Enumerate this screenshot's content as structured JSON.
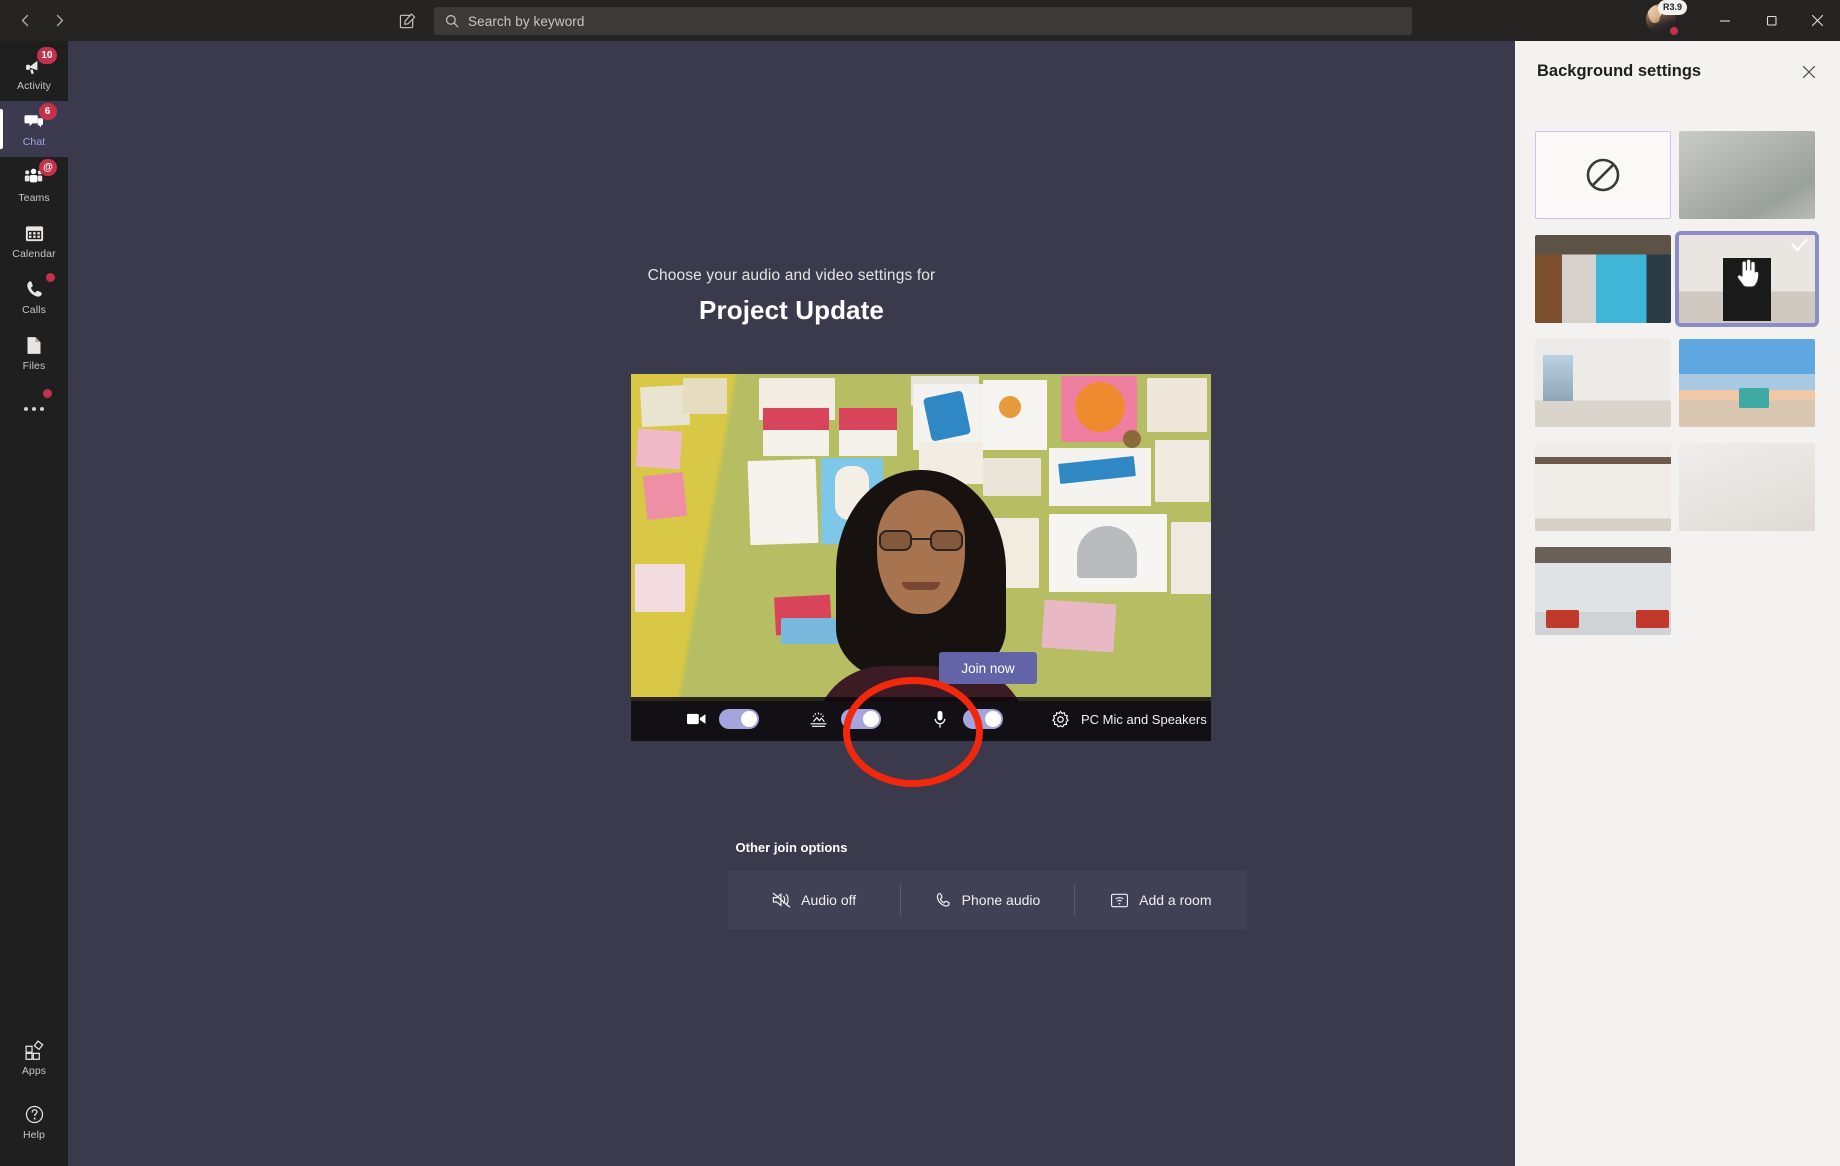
{
  "app": {
    "name": "Microsoft Teams",
    "colors": {
      "accent": "#6264a7",
      "toggle_on": "#a6a4dd",
      "badge_red": "#c4314b",
      "annotation_red": "#f2280c",
      "stage_bg": "#3b3a4c",
      "panel_bg": "#f3f2f1",
      "rail_bg": "#201f1f",
      "titlebar_bg": "#252423"
    }
  },
  "titlebar": {
    "back_icon": "chevron-left-icon",
    "forward_icon": "chevron-right-icon",
    "compose_icon": "compose-new-chat-icon",
    "search": {
      "icon": "search-icon",
      "placeholder": "Search by keyword",
      "value": ""
    },
    "avatar": {
      "icon": "avatar",
      "badge_label": "R3.9",
      "status": "busy"
    },
    "window_controls": {
      "minimize": "—",
      "maximize": "❐",
      "close": "✕"
    }
  },
  "rail": {
    "items": [
      {
        "label": "Activity",
        "icon": "activity-bell-icon",
        "badge": "10",
        "badge_type": "number",
        "active": false
      },
      {
        "label": "Chat",
        "icon": "chat-bubble-icon",
        "badge": "6",
        "badge_type": "number",
        "active": true
      },
      {
        "label": "Teams",
        "icon": "teams-people-icon",
        "badge": "@",
        "badge_type": "number",
        "active": false
      },
      {
        "label": "Calendar",
        "icon": "calendar-icon",
        "badge": "",
        "badge_type": "none",
        "active": false
      },
      {
        "label": "Calls",
        "icon": "phone-icon",
        "badge": "",
        "badge_type": "dot",
        "active": false
      },
      {
        "label": "Files",
        "icon": "file-icon",
        "badge": "",
        "badge_type": "none",
        "active": false
      },
      {
        "label": "",
        "icon": "more-ellipsis-icon",
        "badge": "",
        "badge_type": "dot",
        "active": false
      }
    ],
    "bottom_items": [
      {
        "label": "Apps",
        "icon": "apps-grid-icon"
      },
      {
        "label": "Help",
        "icon": "help-question-icon"
      }
    ]
  },
  "prejoin": {
    "subtitle": "Choose your audio and video settings for",
    "meeting_title": "Project Update",
    "join_button": "Join now",
    "device_bar": {
      "camera": {
        "icon": "camera-icon",
        "toggle_on": true
      },
      "background": {
        "icon": "background-effects-icon",
        "toggle_on": true
      },
      "microphone": {
        "icon": "microphone-icon",
        "toggle_on": true
      },
      "settings_icon": "gear-icon",
      "device_label": "PC Mic and Speakers"
    },
    "other_join": {
      "title": "Other join options",
      "options": [
        {
          "label": "Audio off",
          "icon": "speaker-muted-icon"
        },
        {
          "label": "Phone audio",
          "icon": "phone-handset-icon"
        },
        {
          "label": "Add a room",
          "icon": "room-device-icon"
        }
      ]
    }
  },
  "background_panel": {
    "title": "Background settings",
    "close_icon": "close-icon",
    "selected_index": 3,
    "thumbnails": [
      {
        "name": "none",
        "art": "none",
        "selected": false,
        "has_check": false,
        "outlined": true
      },
      {
        "name": "blur",
        "art": "t-blurgray",
        "selected": false,
        "has_check": false,
        "outlined": false
      },
      {
        "name": "lockers-hallway",
        "art": "t-lockers",
        "selected": false,
        "has_check": false,
        "outlined": false
      },
      {
        "name": "mirror-room",
        "art": "t-mirror",
        "selected": true,
        "has_check": true,
        "outlined": false
      },
      {
        "name": "living-room-window",
        "art": "t-livingroom",
        "selected": false,
        "has_check": false,
        "outlined": false
      },
      {
        "name": "beach-lifeguard",
        "art": "t-beach",
        "selected": false,
        "has_check": false,
        "outlined": false
      },
      {
        "name": "wood-beam-room",
        "art": "t-beam",
        "selected": false,
        "has_check": false,
        "outlined": false
      },
      {
        "name": "plain-wall",
        "art": "t-plainwall",
        "selected": false,
        "has_check": false,
        "outlined": false
      },
      {
        "name": "open-office",
        "art": "t-office",
        "selected": false,
        "has_check": false,
        "outlined": false
      }
    ],
    "cursor": "hand-pointer-cursor"
  },
  "annotation": {
    "shape": "ellipse",
    "color": "#f2280c",
    "target": "background-effects-toggle"
  }
}
